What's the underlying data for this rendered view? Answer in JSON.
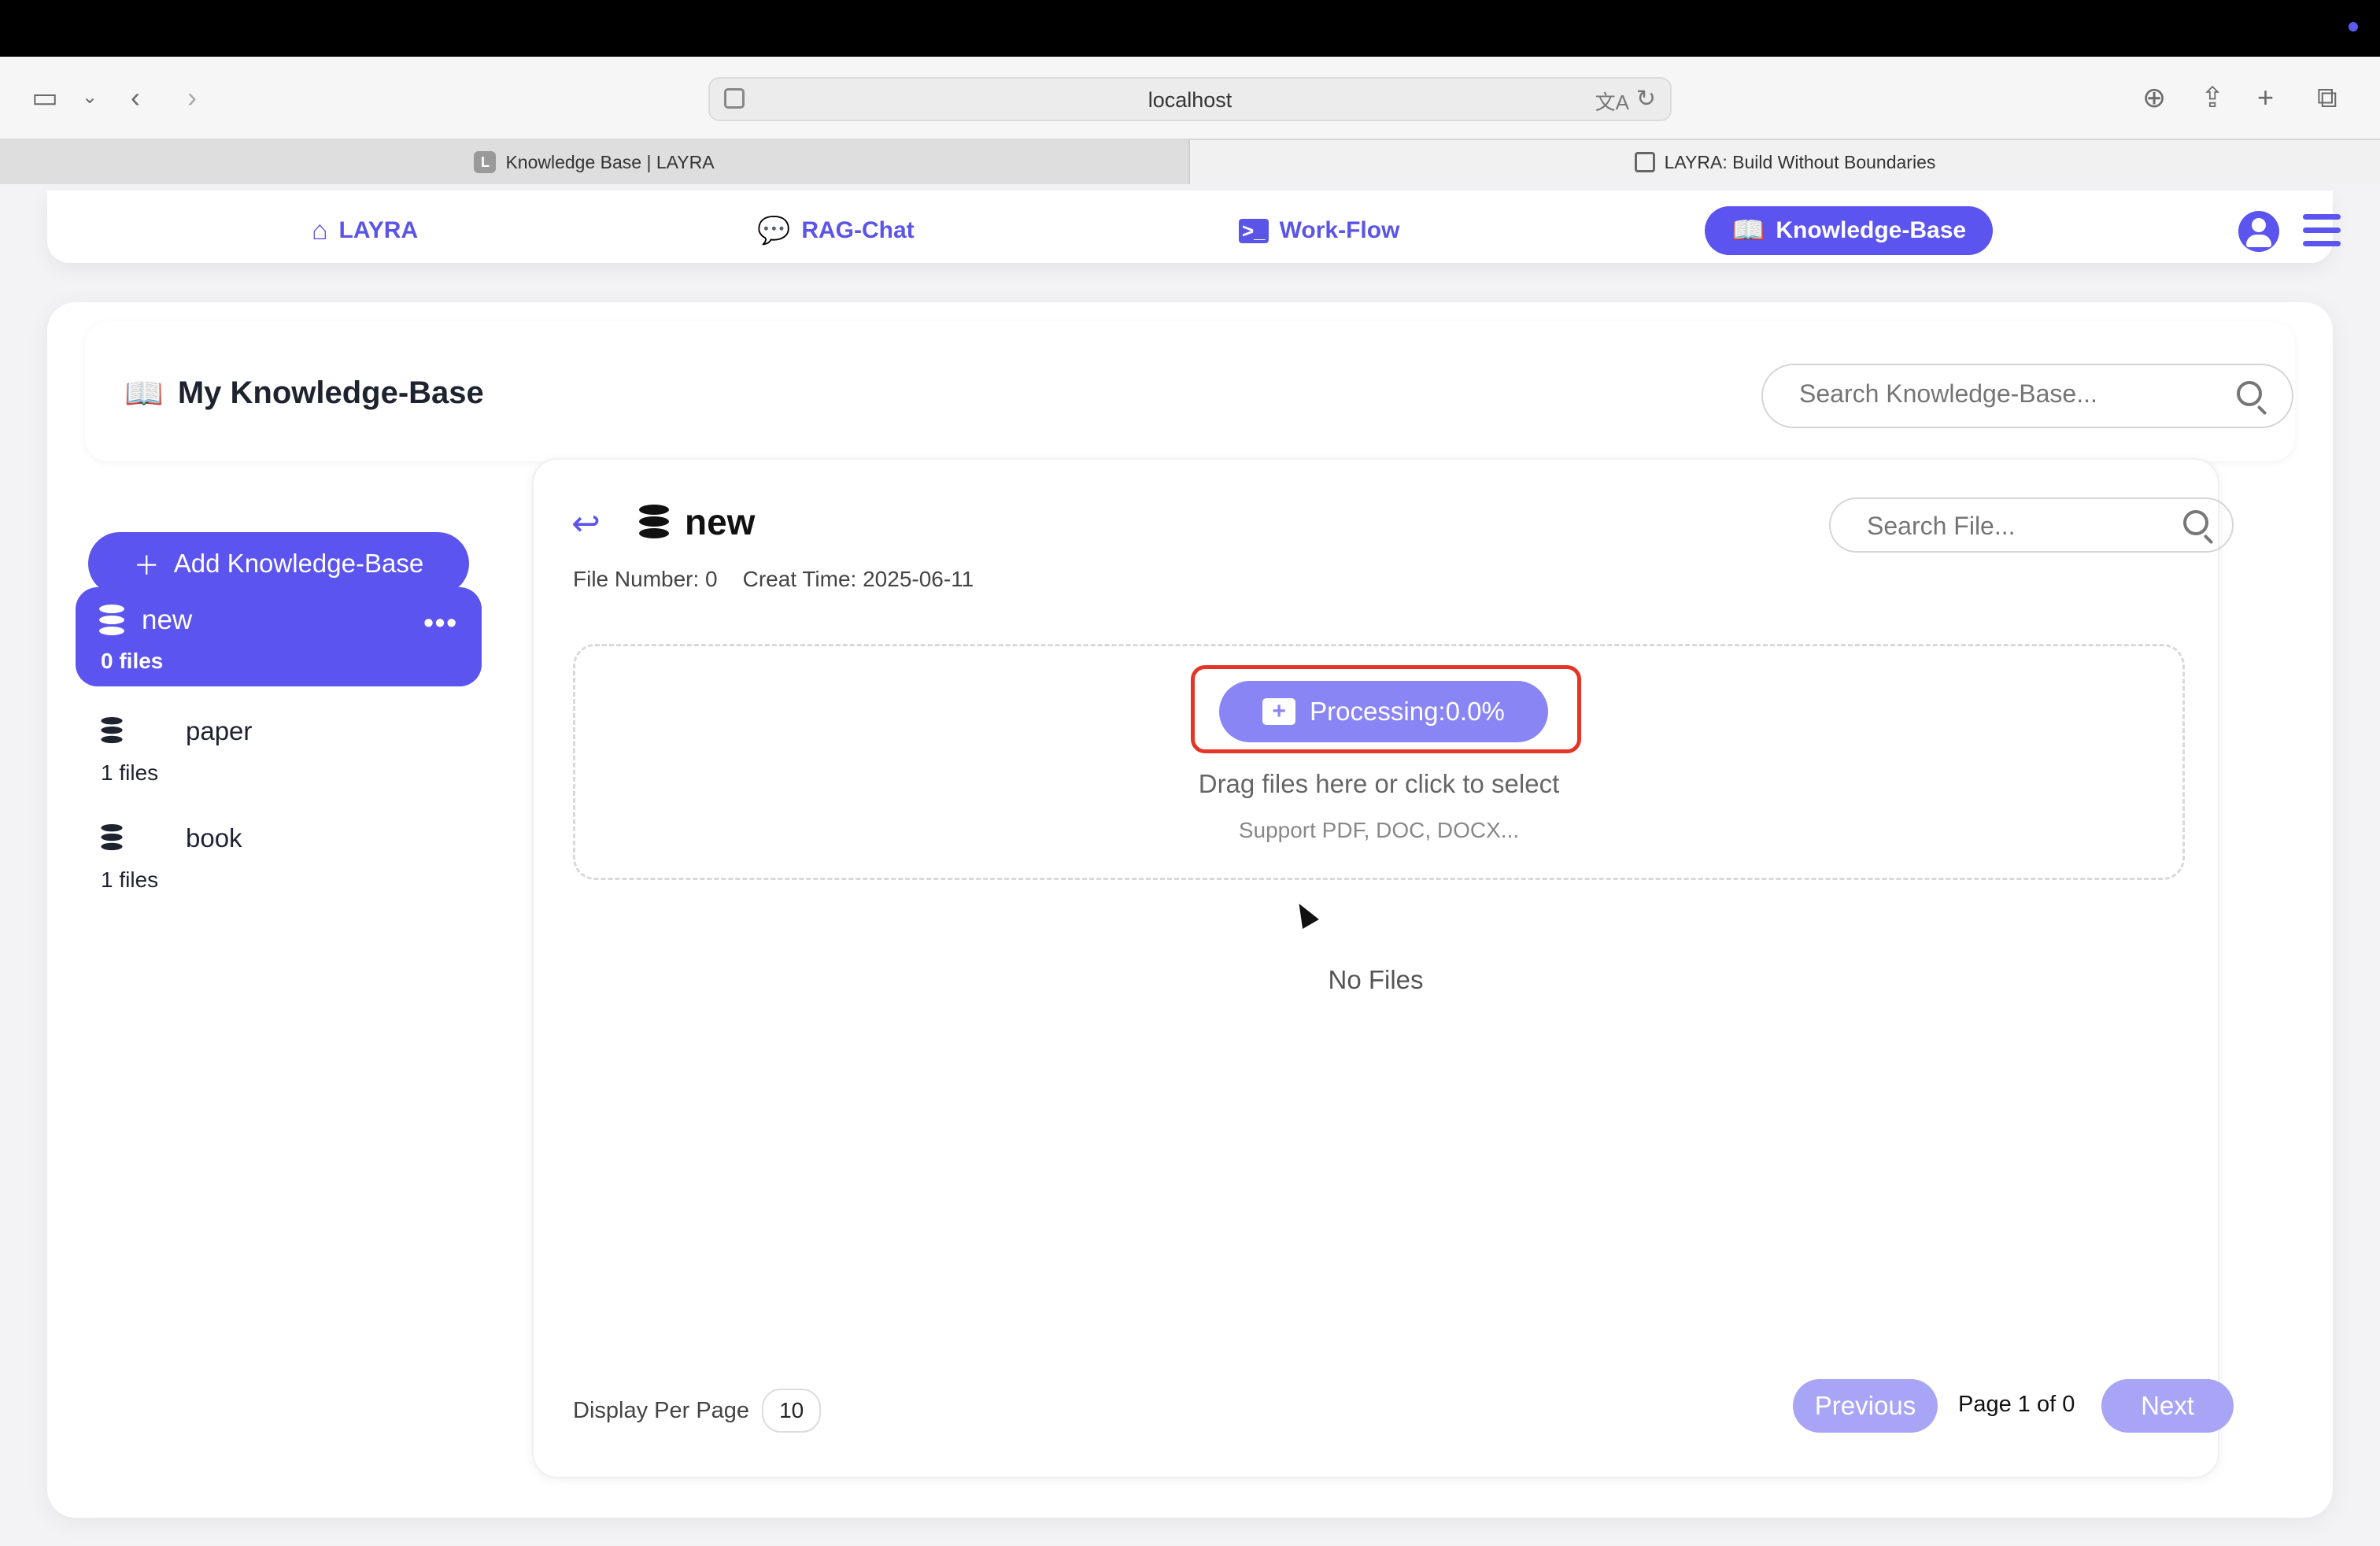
{
  "browser": {
    "url": "localhost",
    "tabs": [
      {
        "title": "Knowledge Base | LAYRA",
        "favicon_letter": "L"
      },
      {
        "title": "LAYRA: Build Without Boundaries"
      }
    ]
  },
  "nav": {
    "items": [
      {
        "label": "LAYRA",
        "icon": "home-icon"
      },
      {
        "label": "RAG-Chat",
        "icon": "chat-icon"
      },
      {
        "label": "Work-Flow",
        "icon": "terminal-icon"
      },
      {
        "label": "Knowledge-Base",
        "icon": "book-icon",
        "active": true
      }
    ]
  },
  "header": {
    "title": "My Knowledge-Base",
    "search_placeholder": "Search Knowledge-Base..."
  },
  "sidebar": {
    "add_label": "Add Knowledge-Base",
    "items": [
      {
        "name": "new",
        "count": "0 files",
        "active": true
      },
      {
        "name": "paper",
        "count": "1 files"
      },
      {
        "name": "book",
        "count": "1 files"
      }
    ]
  },
  "panel": {
    "title": "new",
    "file_number": "File Number: 0",
    "create_time": "Creat Time: 2025-06-11",
    "search_placeholder": "Search File...",
    "upload": {
      "button_label": "Processing:0.0%",
      "progress_percent": 0.0,
      "drop_text": "Drag files here or click to select",
      "support_text": "Support PDF, DOC, DOCX..."
    },
    "empty_text": "No Files",
    "pagination": {
      "per_page_label": "Display Per Page",
      "per_page_value": "10",
      "previous_label": "Previous",
      "page_info": "Page 1 of 0",
      "next_label": "Next"
    }
  },
  "colors": {
    "accent": "#5b54ef",
    "accent_light": "#8a85f4",
    "highlight_box": "#e53527"
  }
}
